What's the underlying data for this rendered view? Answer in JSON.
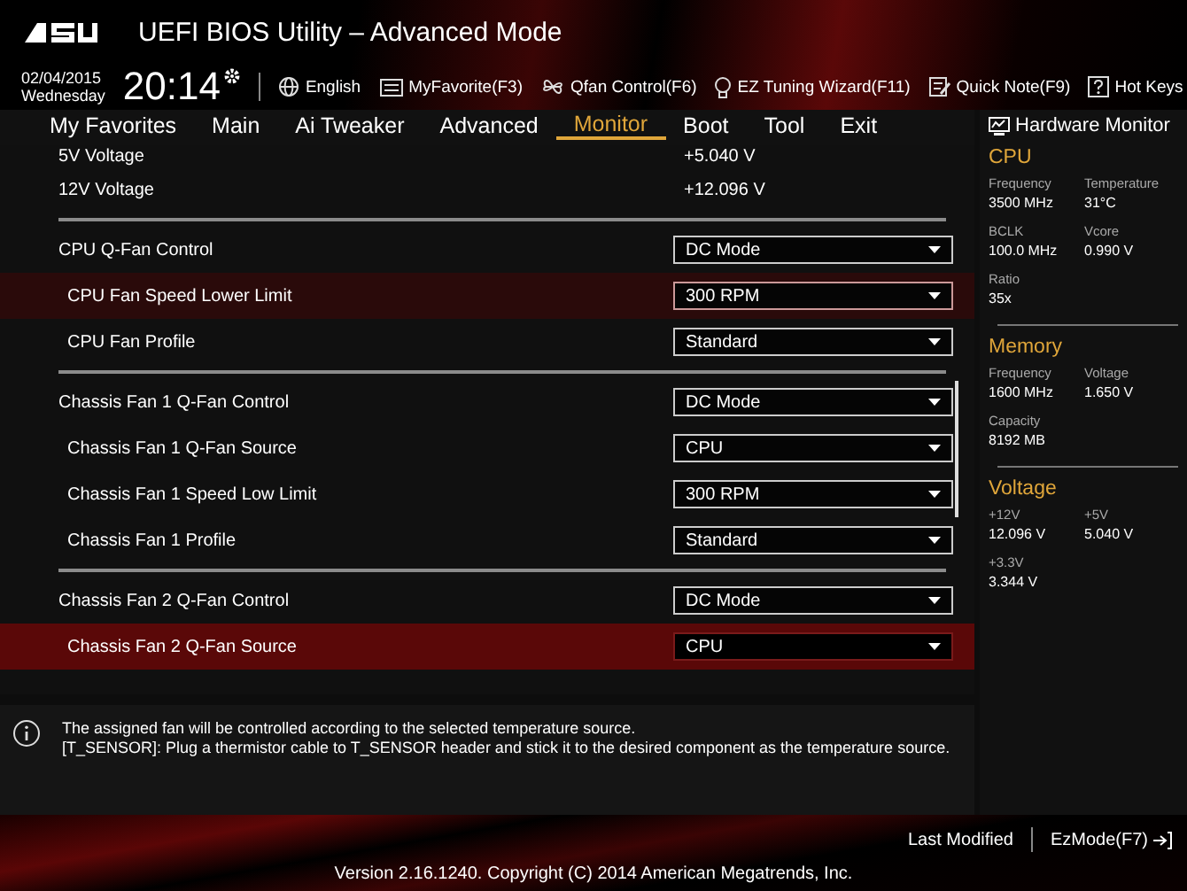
{
  "header": {
    "title": "UEFI BIOS Utility – Advanced Mode",
    "date": "02/04/2015",
    "weekday": "Wednesday",
    "time": "20:14",
    "tools": [
      {
        "kind": "globe",
        "label": "English"
      },
      {
        "kind": "favorite",
        "label": "MyFavorite(F3)"
      },
      {
        "kind": "fan",
        "label": "Qfan Control(F6)"
      },
      {
        "kind": "bulb",
        "label": "EZ Tuning Wizard(F11)"
      },
      {
        "kind": "note",
        "label": "Quick Note(F9)"
      },
      {
        "kind": "help",
        "label": "Hot Keys"
      }
    ]
  },
  "tabs": [
    {
      "label": "My Favorites",
      "selected": false
    },
    {
      "label": "Main",
      "selected": false
    },
    {
      "label": "Ai Tweaker",
      "selected": false
    },
    {
      "label": "Advanced",
      "selected": false
    },
    {
      "label": "Monitor",
      "selected": true
    },
    {
      "label": "Boot",
      "selected": false
    },
    {
      "label": "Tool",
      "selected": false
    },
    {
      "label": "Exit",
      "selected": false
    }
  ],
  "settings": [
    {
      "items": [
        {
          "kind": "reading",
          "label": "5V Voltage",
          "value": "+5.040 V",
          "selected": false,
          "hovered": false
        },
        {
          "kind": "reading",
          "label": "12V Voltage",
          "value": "+12.096 V",
          "selected": false,
          "hovered": false
        }
      ]
    },
    {
      "items": [
        {
          "kind": "dropdown",
          "label": "CPU Q-Fan Control",
          "value": "DC Mode",
          "selected": false,
          "hovered": false,
          "children": [
            {
              "kind": "dropdown",
              "label": "CPU Fan Speed Lower Limit",
              "value": "300 RPM",
              "selected": false,
              "hovered": true
            },
            {
              "kind": "dropdown",
              "label": "CPU Fan Profile",
              "value": "Standard",
              "selected": false,
              "hovered": false
            }
          ]
        }
      ]
    },
    {
      "items": [
        {
          "kind": "dropdown",
          "label": "Chassis Fan 1 Q-Fan Control",
          "value": "DC Mode",
          "selected": false,
          "hovered": false,
          "children": [
            {
              "kind": "dropdown",
              "label": "Chassis Fan 1 Q-Fan Source",
              "value": "CPU",
              "selected": false,
              "hovered": false
            },
            {
              "kind": "dropdown",
              "label": "Chassis Fan 1 Speed Low Limit",
              "value": "300 RPM",
              "selected": false,
              "hovered": false
            },
            {
              "kind": "dropdown",
              "label": "Chassis Fan 1 Profile",
              "value": "Standard",
              "selected": false,
              "hovered": false
            }
          ]
        }
      ]
    },
    {
      "items": [
        {
          "kind": "dropdown",
          "label": "Chassis Fan 2 Q-Fan Control",
          "value": "DC Mode",
          "selected": false,
          "hovered": false,
          "children": [
            {
              "kind": "dropdown",
              "label": "Chassis Fan 2 Q-Fan Source",
              "value": "CPU",
              "selected": true,
              "hovered": false
            }
          ]
        }
      ]
    }
  ],
  "info": [
    "The assigned fan will be controlled according to the selected temperature source.",
    "[T_SENSOR]: Plug a thermistor cable to T_SENSOR header and stick it to the desired component as the temperature source."
  ],
  "hardware_monitor": {
    "title": "Hardware Monitor",
    "sections": [
      {
        "title": "CPU",
        "fields": [
          {
            "label": "Frequency",
            "value": "3500 MHz"
          },
          {
            "label": "Temperature",
            "value": "31°C"
          },
          {
            "label": "BCLK",
            "value": "100.0 MHz"
          },
          {
            "label": "Vcore",
            "value": "0.990 V"
          },
          {
            "label": "Ratio",
            "value": "35x"
          }
        ]
      },
      {
        "title": "Memory",
        "fields": [
          {
            "label": "Frequency",
            "value": "1600 MHz"
          },
          {
            "label": "Voltage",
            "value": "1.650 V"
          },
          {
            "label": "Capacity",
            "value": "8192 MB"
          }
        ]
      },
      {
        "title": "Voltage",
        "fields": [
          {
            "label": "+12V",
            "value": "12.096 V"
          },
          {
            "label": "+5V",
            "value": "5.040 V"
          },
          {
            "label": "+3.3V",
            "value": "3.344 V"
          }
        ]
      }
    ]
  },
  "footer": {
    "last_modified": "Last Modified",
    "ez_mode": "EzMode(F7)",
    "version": "Version 2.16.1240. Copyright (C) 2014 American Megatrends, Inc."
  }
}
